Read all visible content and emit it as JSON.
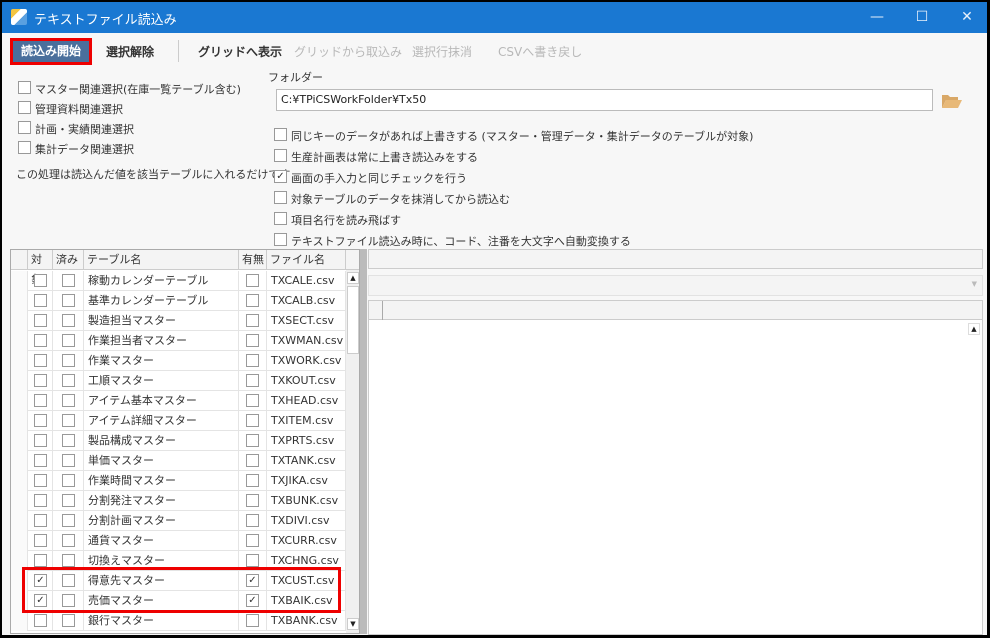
{
  "window": {
    "title": "テキストファイル読込み",
    "minimize": "—",
    "maximize": "☐",
    "close": "✕"
  },
  "toolbar": {
    "start": "読込み開始",
    "deselect": "選択解除",
    "show_grid": "グリッドへ表示",
    "import_grid": "グリッドから取込み",
    "delete_rows": "選択行抹消",
    "write_csv": "CSVへ書き戻し"
  },
  "left_options": [
    {
      "label": "マスター関連選択(在庫一覧テーブル含む)",
      "checked": false
    },
    {
      "label": "管理資料関連選択",
      "checked": false
    },
    {
      "label": "計画・実績関連選択",
      "checked": false
    },
    {
      "label": "集計データ関連選択",
      "checked": false
    }
  ],
  "note": "この処理は読込んだ値を該当テーブルに入れるだけです",
  "folder": {
    "label": "フォルダー",
    "value": "C:¥TPiCSWorkFolder¥Tx50"
  },
  "options": [
    {
      "label": "同じキーのデータがあれば上書きする (マスター・管理データ・集計データのテーブルが対象)",
      "checked": false
    },
    {
      "label": "生産計画表は常に上書き読込みをする",
      "checked": false
    },
    {
      "label": "画面の手入力と同じチェックを行う",
      "checked": true
    },
    {
      "label": "対象テーブルのデータを抹消してから読込む",
      "checked": false
    },
    {
      "label": "項目名行を読み飛ばす",
      "checked": false
    },
    {
      "label": "テキストファイル読込み時に、コード、注番を大文字へ自動変換する",
      "checked": false
    }
  ],
  "grid": {
    "headers": [
      "対象",
      "済み",
      "テーブル名",
      "有無",
      "ファイル名"
    ],
    "rows": [
      {
        "target": false,
        "done": false,
        "table": "稼動カレンダーテーブル",
        "exists": false,
        "file": "TXCALE.csv"
      },
      {
        "target": false,
        "done": false,
        "table": "基準カレンダーテーブル",
        "exists": false,
        "file": "TXCALB.csv"
      },
      {
        "target": false,
        "done": false,
        "table": "製造担当マスター",
        "exists": false,
        "file": "TXSECT.csv"
      },
      {
        "target": false,
        "done": false,
        "table": "作業担当者マスター",
        "exists": false,
        "file": "TXWMAN.csv"
      },
      {
        "target": false,
        "done": false,
        "table": "作業マスター",
        "exists": false,
        "file": "TXWORK.csv"
      },
      {
        "target": false,
        "done": false,
        "table": "工順マスター",
        "exists": false,
        "file": "TXKOUT.csv"
      },
      {
        "target": false,
        "done": false,
        "table": "アイテム基本マスター",
        "exists": false,
        "file": "TXHEAD.csv"
      },
      {
        "target": false,
        "done": false,
        "table": "アイテム詳細マスター",
        "exists": false,
        "file": "TXITEM.csv"
      },
      {
        "target": false,
        "done": false,
        "table": "製品構成マスター",
        "exists": false,
        "file": "TXPRTS.csv"
      },
      {
        "target": false,
        "done": false,
        "table": "単価マスター",
        "exists": false,
        "file": "TXTANK.csv"
      },
      {
        "target": false,
        "done": false,
        "table": "作業時間マスター",
        "exists": false,
        "file": "TXJIKA.csv"
      },
      {
        "target": false,
        "done": false,
        "table": "分割発注マスター",
        "exists": false,
        "file": "TXBUNK.csv"
      },
      {
        "target": false,
        "done": false,
        "table": "分割計画マスター",
        "exists": false,
        "file": "TXDIVI.csv"
      },
      {
        "target": false,
        "done": false,
        "table": "通貨マスター",
        "exists": false,
        "file": "TXCURR.csv"
      },
      {
        "target": false,
        "done": false,
        "table": "切換えマスター",
        "exists": false,
        "file": "TXCHNG.csv"
      },
      {
        "target": true,
        "done": false,
        "table": "得意先マスター",
        "exists": true,
        "file": "TXCUST.csv"
      },
      {
        "target": true,
        "done": false,
        "table": "売価マスター",
        "exists": true,
        "file": "TXBAIK.csv"
      },
      {
        "target": false,
        "done": false,
        "table": "銀行マスター",
        "exists": false,
        "file": "TXBANK.csv"
      }
    ]
  },
  "icons": {
    "check": "✓",
    "scroll_up": "▲",
    "scroll_down": "▼"
  }
}
